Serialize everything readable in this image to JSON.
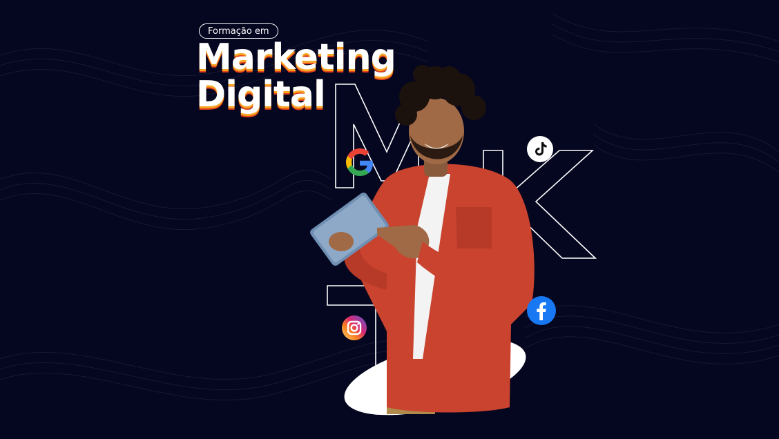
{
  "badge": {
    "label": "Formação em"
  },
  "headline": {
    "line1": "Marketing",
    "line2": "Digital"
  },
  "outline_letters": [
    "M",
    "K",
    "T"
  ],
  "icons": [
    "google-icon",
    "tiktok-icon",
    "instagram-icon",
    "facebook-icon"
  ],
  "colors": {
    "background": "#05061f",
    "headline_shadow_1": "#f5a623",
    "headline_shadow_2": "#e8411b",
    "shirt": "#c9432f",
    "tablet": "#6f8fb3",
    "facebook": "#1877f2"
  }
}
